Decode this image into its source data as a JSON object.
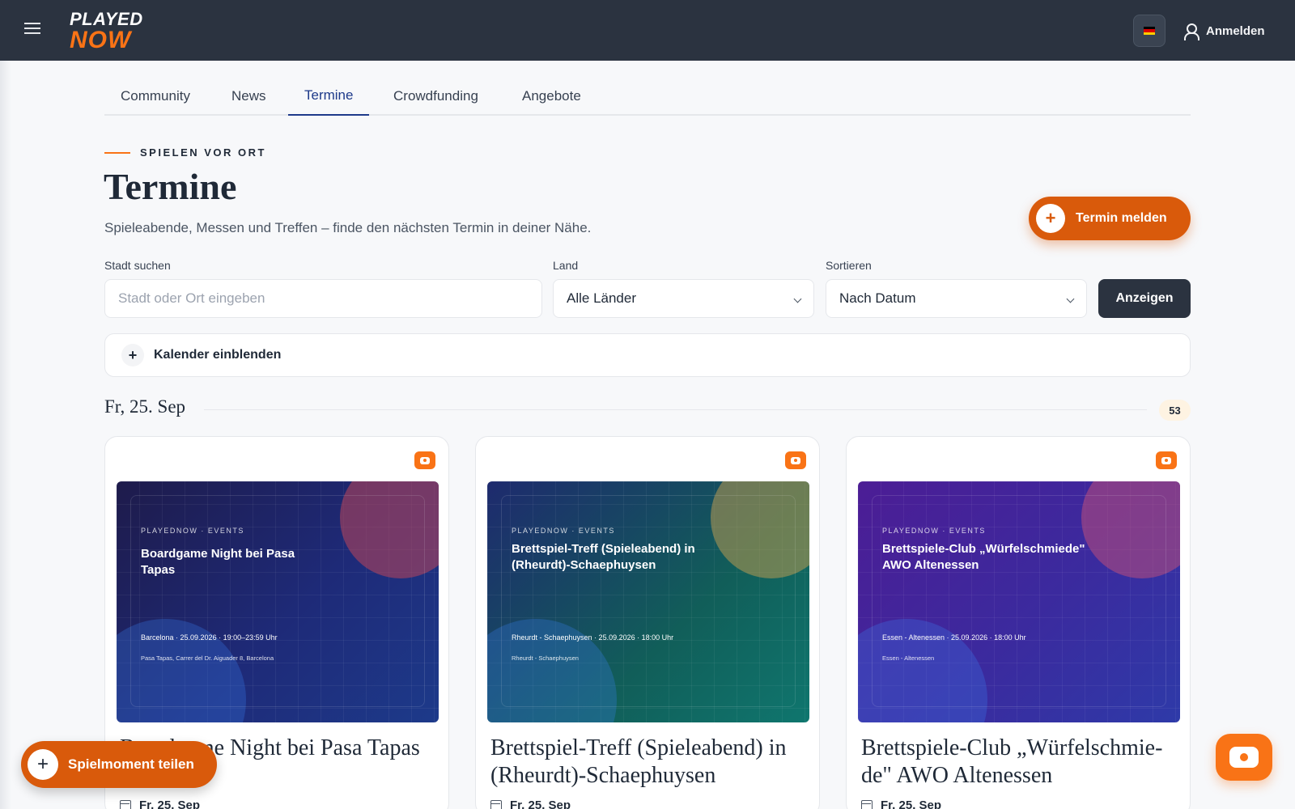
{
  "header": {
    "logo_top": "PLAYED",
    "logo_bottom": "NOW",
    "login_label": "Anmelden",
    "flag_colors": [
      "#000000",
      "#dd0000",
      "#ffce00"
    ]
  },
  "tabs": [
    {
      "label": "Community",
      "active": false
    },
    {
      "label": "News",
      "active": false
    },
    {
      "label": "Termine",
      "active": true
    },
    {
      "label": "Crowdfunding",
      "active": false
    },
    {
      "label": "Angebote",
      "active": false
    }
  ],
  "page": {
    "kicker": "SPIELEN VOR ORT",
    "title": "Termine",
    "subtitle": "Spieleabende, Messen und Treffen – finde den nächsten Termin in deiner Nähe.",
    "cta_label": "Termin melden",
    "cta_plus": "+"
  },
  "filters": {
    "city_label": "Stadt suchen",
    "city_placeholder": "Stadt oder Ort eingeben",
    "city_value": "",
    "country_label": "Land",
    "country_value": "Alle Länder",
    "sort_label": "Sortieren",
    "sort_value": "Nach Datum",
    "submit_label": "Anzeigen"
  },
  "calendar_toggle": {
    "plus": "+",
    "label": "Kalender einblenden"
  },
  "date_group": {
    "date": "Fr, 25. Sep",
    "count": "53"
  },
  "cards": [
    {
      "thumb_kicker": "PLAYEDNOW · EVENTS",
      "thumb_title": "Boardgame Night bei Pasa Tapas",
      "thumb_meta": "Barcelona · 25.09.2026 · 19:00–23:59 Uhr",
      "thumb_addr": "Pasa Tapas, Carrer del Dr. Aiguader 8, Barcelona",
      "title": "Boardgame Night bei Pasa Tapas",
      "date": "Fr, 25. Sep",
      "bg": "linear-gradient(135deg, #1e1b4b 0%, #1e2a78 55%, #1d3a8a 100%)",
      "circle": "rgba(190,70,90,0.55)"
    },
    {
      "thumb_kicker": "PLAYEDNOW · EVENTS",
      "thumb_title": "Brettspiel-Treff (Spieleabend) in (Rheurdt)-Schaephuysen",
      "thumb_meta": "Rheurdt - Schaephuysen · 25.09.2026 · 18:00 Uhr",
      "thumb_addr": "Rheurdt - Schaephuysen",
      "title": "Brettspiel-Treff (Spieleabend) in (Rheurdt)-Schaephuysen",
      "date": "Fr, 25. Sep",
      "bg": "linear-gradient(135deg, #1e2a6e 0%, #115e59 60%, #0f766e 100%)",
      "circle": "rgba(200,160,80,0.5)"
    },
    {
      "thumb_kicker": "PLAYEDNOW · EVENTS",
      "thumb_title": "Brettspiele-Club „Würfelschmiede\" AWO Altenessen",
      "thumb_meta": "Essen - Altenessen · 25.09.2026 · 18:00 Uhr",
      "thumb_addr": "Essen - Altenessen",
      "title": "Brettspiele-Club „Würfelschmie-de\" AWO Altenessen",
      "date": "Fr, 25. Sep",
      "bg": "linear-gradient(135deg, #4c1d95 0%, #3b2a9e 55%, #2e3aa8 100%)",
      "circle": "rgba(200,80,120,0.5)"
    }
  ],
  "floating": {
    "share_plus": "+",
    "share_label": "Spielmoment teilen"
  },
  "colors": {
    "accent": "#d95a0b",
    "brand_orange": "#f97316",
    "dark": "#2b3340",
    "tab_active": "#1e3a8a"
  },
  "icons": {
    "menu": "hamburger-menu-icon",
    "user": "user-icon",
    "calendar": "calendar-icon",
    "chevron": "chevron-down-icon",
    "source": "playednow-badge-icon",
    "game": "game-controller-icon"
  }
}
